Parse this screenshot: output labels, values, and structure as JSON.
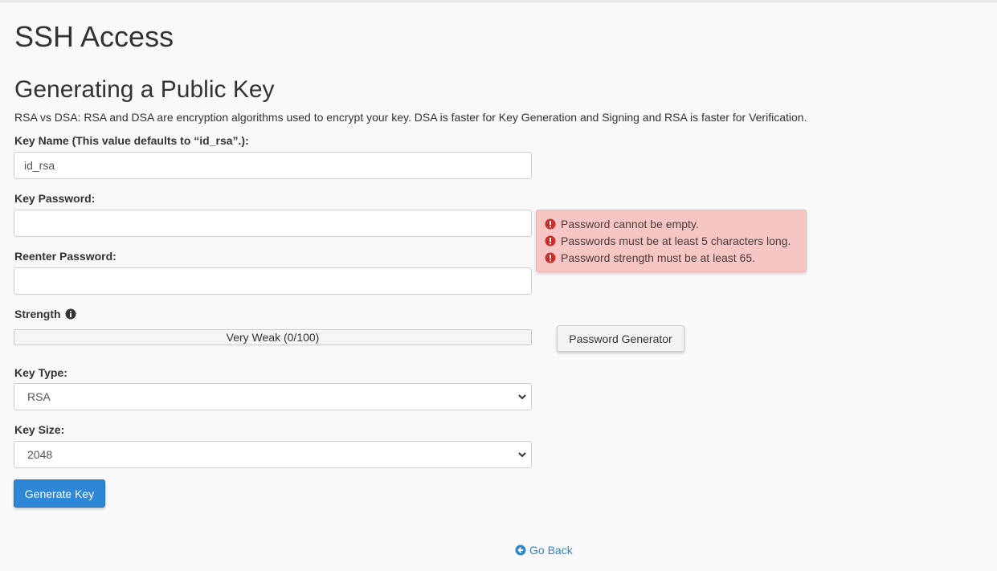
{
  "page": {
    "title": "SSH Access",
    "section_title": "Generating a Public Key",
    "description": "RSA vs DSA: RSA and DSA are encryption algorithms used to encrypt your key. DSA is faster for Key Generation and Signing and RSA is faster for Verification."
  },
  "form": {
    "key_name": {
      "label": "Key Name (This value defaults to “id_rsa”.):",
      "value": "id_rsa"
    },
    "key_password": {
      "label": "Key Password:",
      "value": ""
    },
    "reenter_password": {
      "label": "Reenter Password:",
      "value": ""
    },
    "strength": {
      "label": "Strength",
      "text": "Very Weak (0/100)",
      "percent": 0
    },
    "password_generator_label": "Password Generator",
    "key_type": {
      "label": "Key Type:",
      "selected": "RSA"
    },
    "key_size": {
      "label": "Key Size:",
      "selected": "2048"
    },
    "generate_label": "Generate Key"
  },
  "errors": [
    "Password cannot be empty.",
    "Passwords must be at least 5 characters long.",
    "Password strength must be at least 65."
  ],
  "footer": {
    "go_back_label": "Go Back"
  },
  "icons": {
    "error": "exclamation-circle-icon",
    "info": "info-circle-icon",
    "back": "arrow-circle-left-icon",
    "chevron": "chevron-down-icon"
  },
  "colors": {
    "primary": "#2e86d6",
    "error_bg": "#f6c6c4",
    "error_icon": "#c9302c",
    "link": "#2f86c8"
  }
}
